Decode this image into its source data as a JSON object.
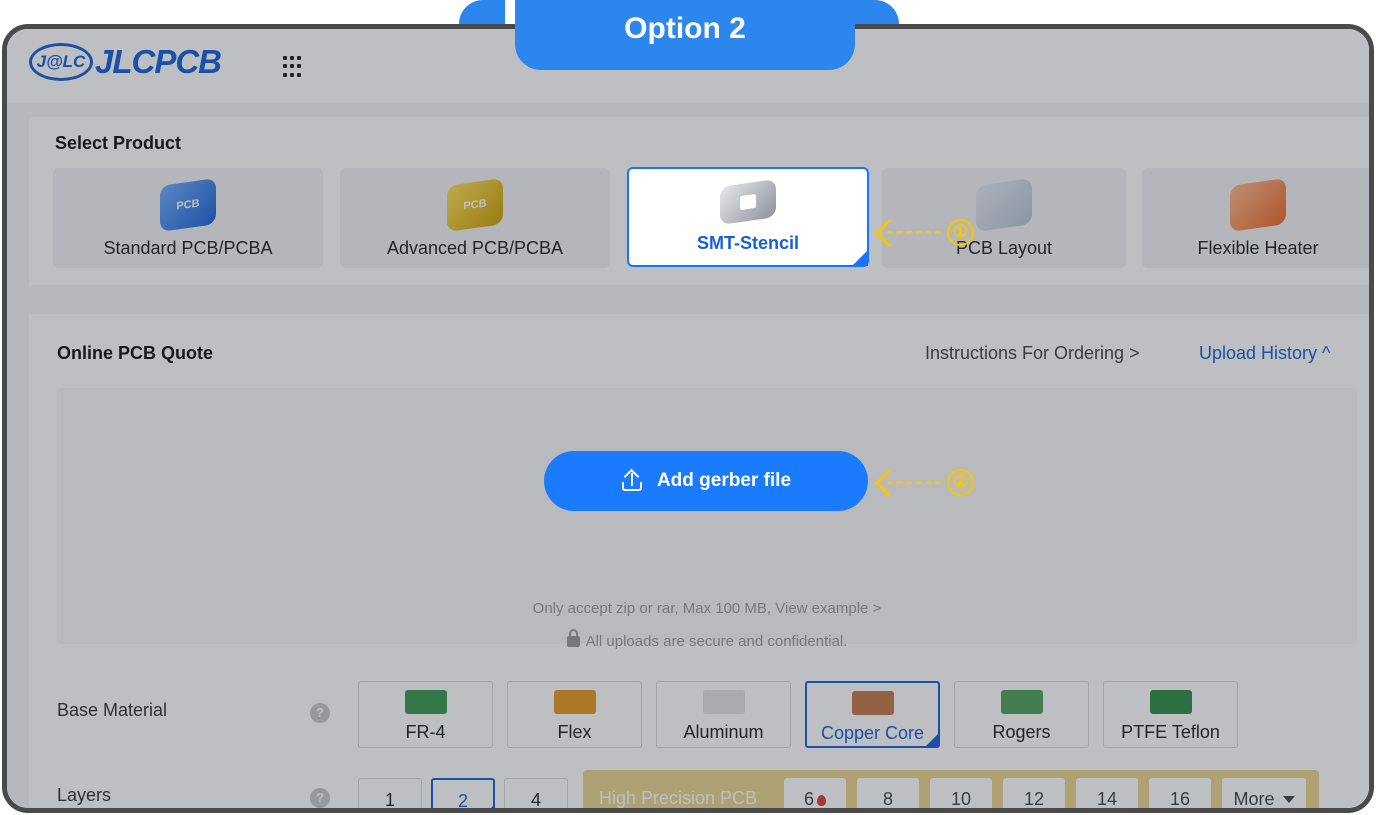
{
  "tab": {
    "title": "Option 2"
  },
  "header": {
    "logo_badge": "J@LC",
    "logo_text": "JLCPCB",
    "apps_icon": "grid-apps-icon"
  },
  "products": {
    "title": "Select Product",
    "items": [
      {
        "label": "Standard PCB/PCBA",
        "badge": "PCB"
      },
      {
        "label": "Advanced PCB/PCBA",
        "badge": "PCB"
      },
      {
        "label": "SMT-Stencil"
      },
      {
        "label": "PCB Layout"
      },
      {
        "label": "Flexible Heater"
      }
    ],
    "selected": "SMT-Stencil"
  },
  "quote": {
    "title": "Online PCB Quote",
    "instructions_link": "Instructions For Ordering >",
    "history_link": "Upload History ^",
    "upload_button": "Add gerber file",
    "accept_note": "Only accept zip or rar, Max 100 MB, View example >",
    "secure_note": "All uploads are secure and confidential."
  },
  "base_material": {
    "label": "Base Material",
    "help": "?",
    "options": [
      "FR-4",
      "Flex",
      "Aluminum",
      "Copper Core",
      "Rogers",
      "PTFE Teflon"
    ],
    "selected": "Copper Core"
  },
  "layers": {
    "label": "Layers",
    "help": "?",
    "options": [
      "1",
      "2",
      "4"
    ],
    "selected": "2",
    "high_precision": {
      "label": "High Precision PCB",
      "options": [
        "6",
        "8",
        "10",
        "12",
        "14",
        "16"
      ],
      "more": "More"
    }
  },
  "annotations": {
    "step1": "①",
    "step2": "②",
    "color": "#f7c600"
  },
  "colors": {
    "accent": "#1a7bff",
    "tab": "#2b86ee",
    "brand": "#1560d8"
  }
}
